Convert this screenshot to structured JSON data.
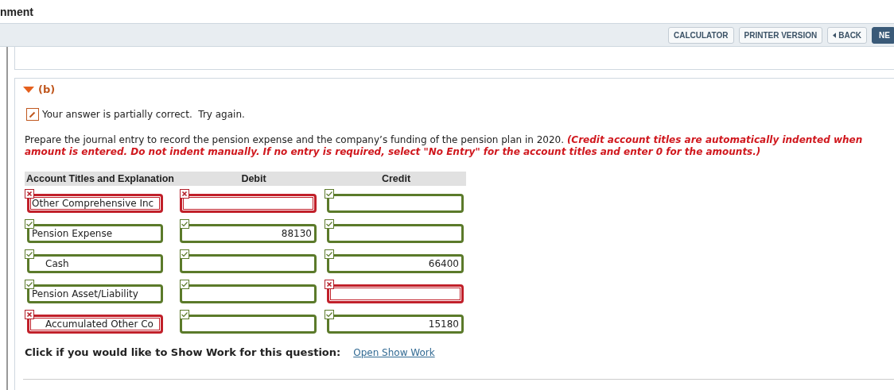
{
  "page_title": "nment",
  "toolbar": {
    "buttons": [
      {
        "label": "CALCULATOR",
        "kind": "plain"
      },
      {
        "label": "PRINTER VERSION",
        "kind": "plain"
      },
      {
        "label": "BACK",
        "kind": "back"
      },
      {
        "label": "NE",
        "kind": "primary"
      }
    ]
  },
  "part": {
    "label": "(b)",
    "expanded": true,
    "feedback": "Your answer is partially correct.  Try again.",
    "instruction": "Prepare the journal entry to record the pension expense and the company’s funding of the pension plan in 2020.",
    "note": "(Credit account titles are automatically indented when amount is entered. Do not indent manually. If no entry is required, select \"No Entry\" for the account titles and enter 0 for the amounts.)",
    "table": {
      "columns": [
        "Account Titles and Explanation",
        "Debit",
        "Credit"
      ],
      "rows": [
        {
          "account": {
            "value": "Other Comprehensive Inc",
            "correct": false,
            "indented": false
          },
          "debit": {
            "correct": false
          },
          "credit": {
            "correct": true
          }
        },
        {
          "account": {
            "value": "Pension Expense",
            "correct": true,
            "indented": false
          },
          "debit": {
            "value": "88130",
            "correct": true
          },
          "credit": {
            "correct": true
          }
        },
        {
          "account": {
            "value": "Cash",
            "correct": true,
            "indented": true
          },
          "debit": {
            "correct": true
          },
          "credit": {
            "value": "66400",
            "correct": true
          }
        },
        {
          "account": {
            "value": "Pension Asset/Liability",
            "correct": true,
            "indented": false
          },
          "debit": {
            "correct": true
          },
          "credit": {
            "correct": false
          }
        },
        {
          "account": {
            "value": "Accumulated Other Co",
            "correct": false,
            "indented": true
          },
          "debit": {
            "correct": true
          },
          "credit": {
            "value": "15180",
            "correct": true
          }
        }
      ]
    },
    "show_work": {
      "label": "Click if you would like to Show Work for this question:",
      "link": "Open Show Work"
    }
  }
}
